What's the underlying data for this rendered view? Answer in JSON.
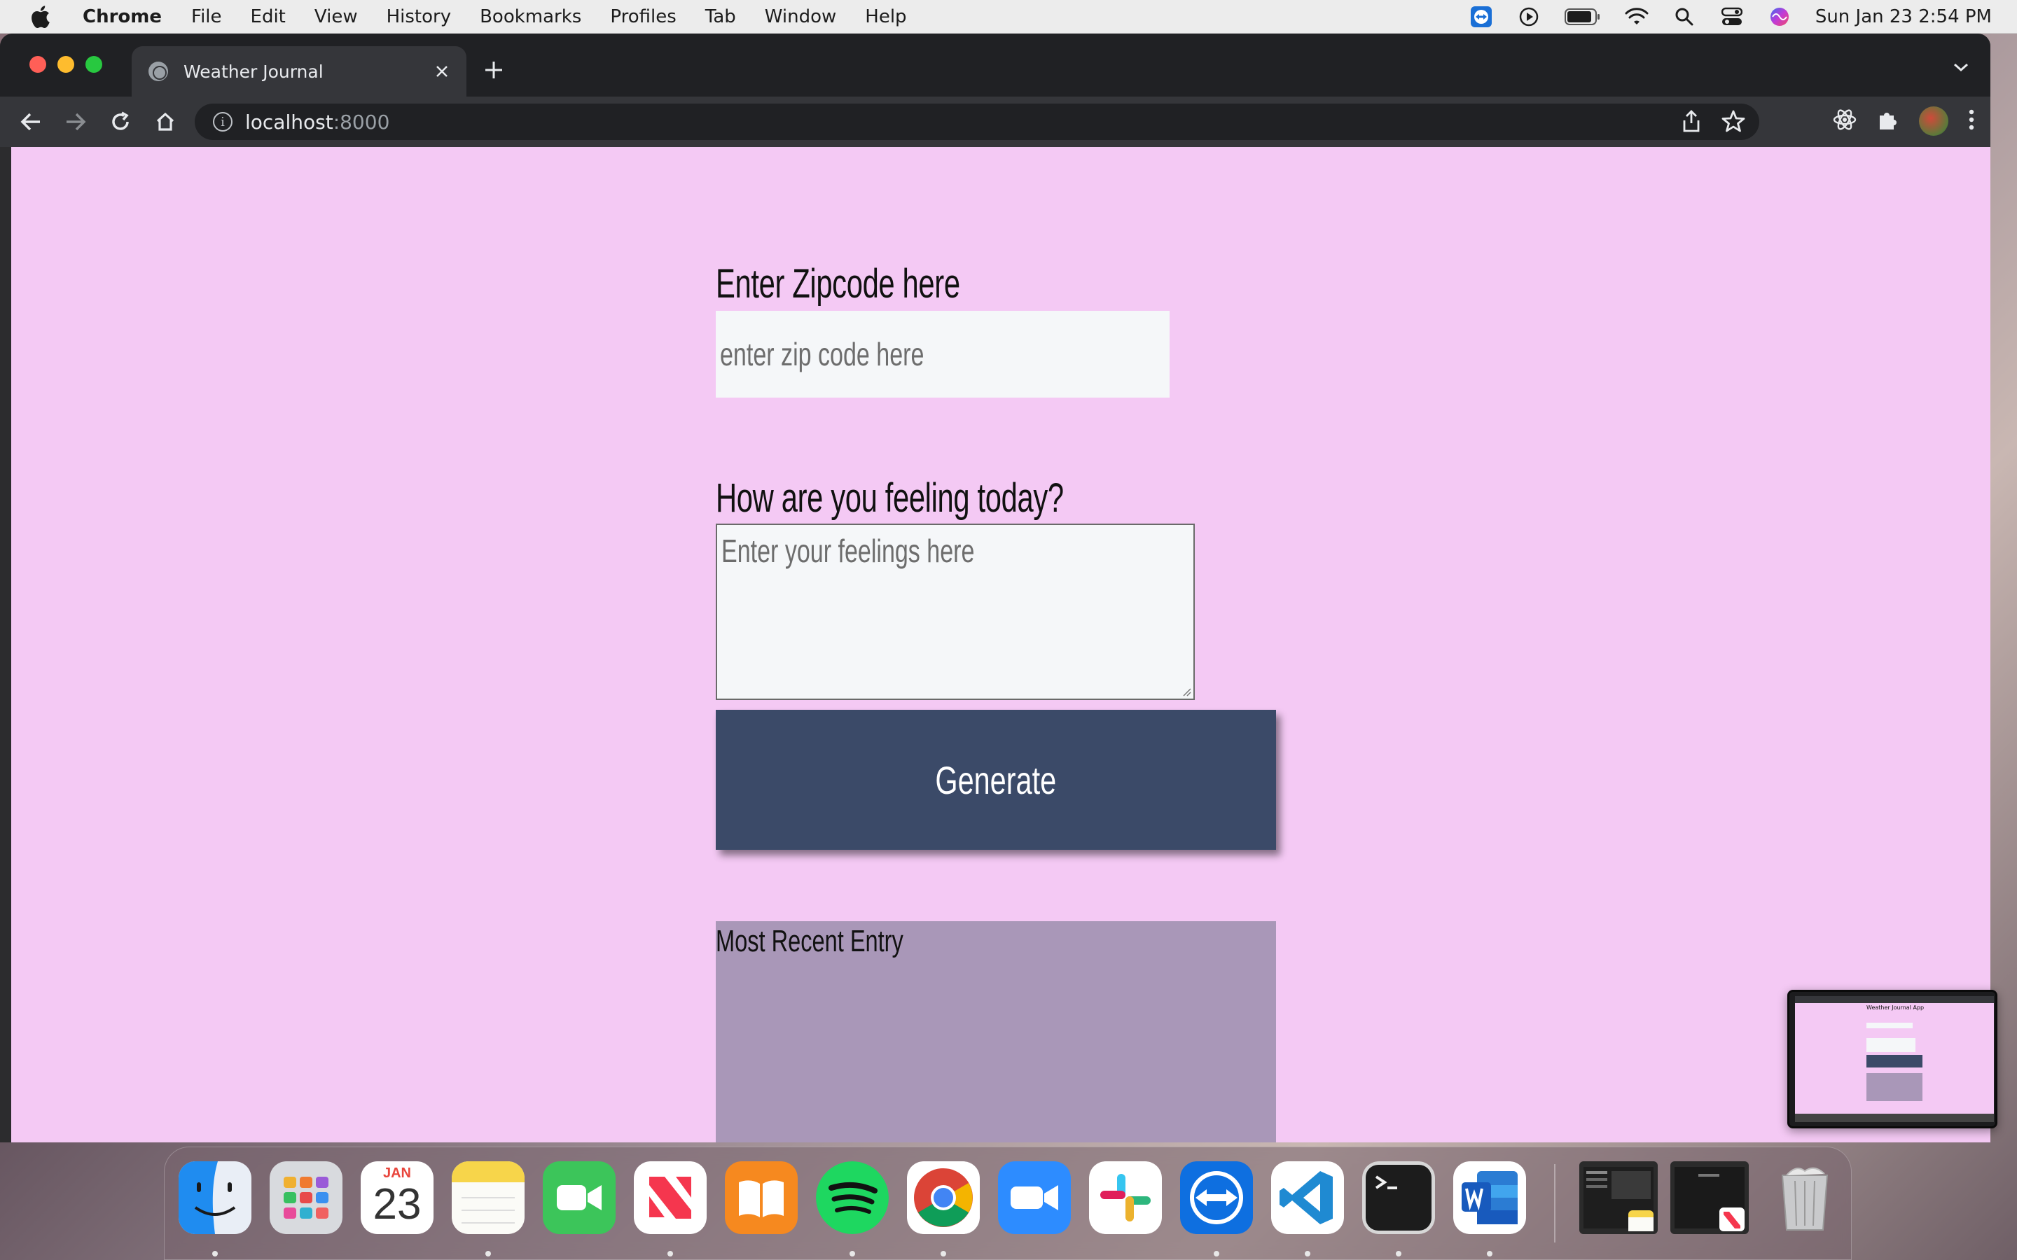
{
  "menubar": {
    "app_name": "Chrome",
    "items": [
      "File",
      "Edit",
      "View",
      "History",
      "Bookmarks",
      "Profiles",
      "Tab",
      "Window",
      "Help"
    ],
    "clock": "Sun Jan 23  2:54 PM"
  },
  "browser": {
    "tab_title": "Weather Journal",
    "url_host": "localhost",
    "url_port": ":8000"
  },
  "page": {
    "zip_label": "Enter Zipcode here",
    "zip_placeholder": "enter zip code here",
    "feelings_label": "How are you feeling today?",
    "feelings_placeholder": "Enter your feelings here",
    "generate_label": "Generate",
    "recent_entry_title": "Most Recent Entry",
    "background_color": "#f4c9f4",
    "button_color": "#3b4a68",
    "entry_color": "#a997b8"
  },
  "pip": {
    "title": "Weather Journal App"
  },
  "dock": {
    "calendar_month": "JAN",
    "calendar_day": "23",
    "apps": [
      "Finder",
      "Launchpad",
      "Calendar",
      "Notes",
      "FaceTime",
      "News",
      "Books",
      "Spotify",
      "Google Chrome",
      "Zoom",
      "Slack",
      "TeamViewer",
      "Visual Studio Code",
      "Terminal",
      "Microsoft Word"
    ]
  }
}
